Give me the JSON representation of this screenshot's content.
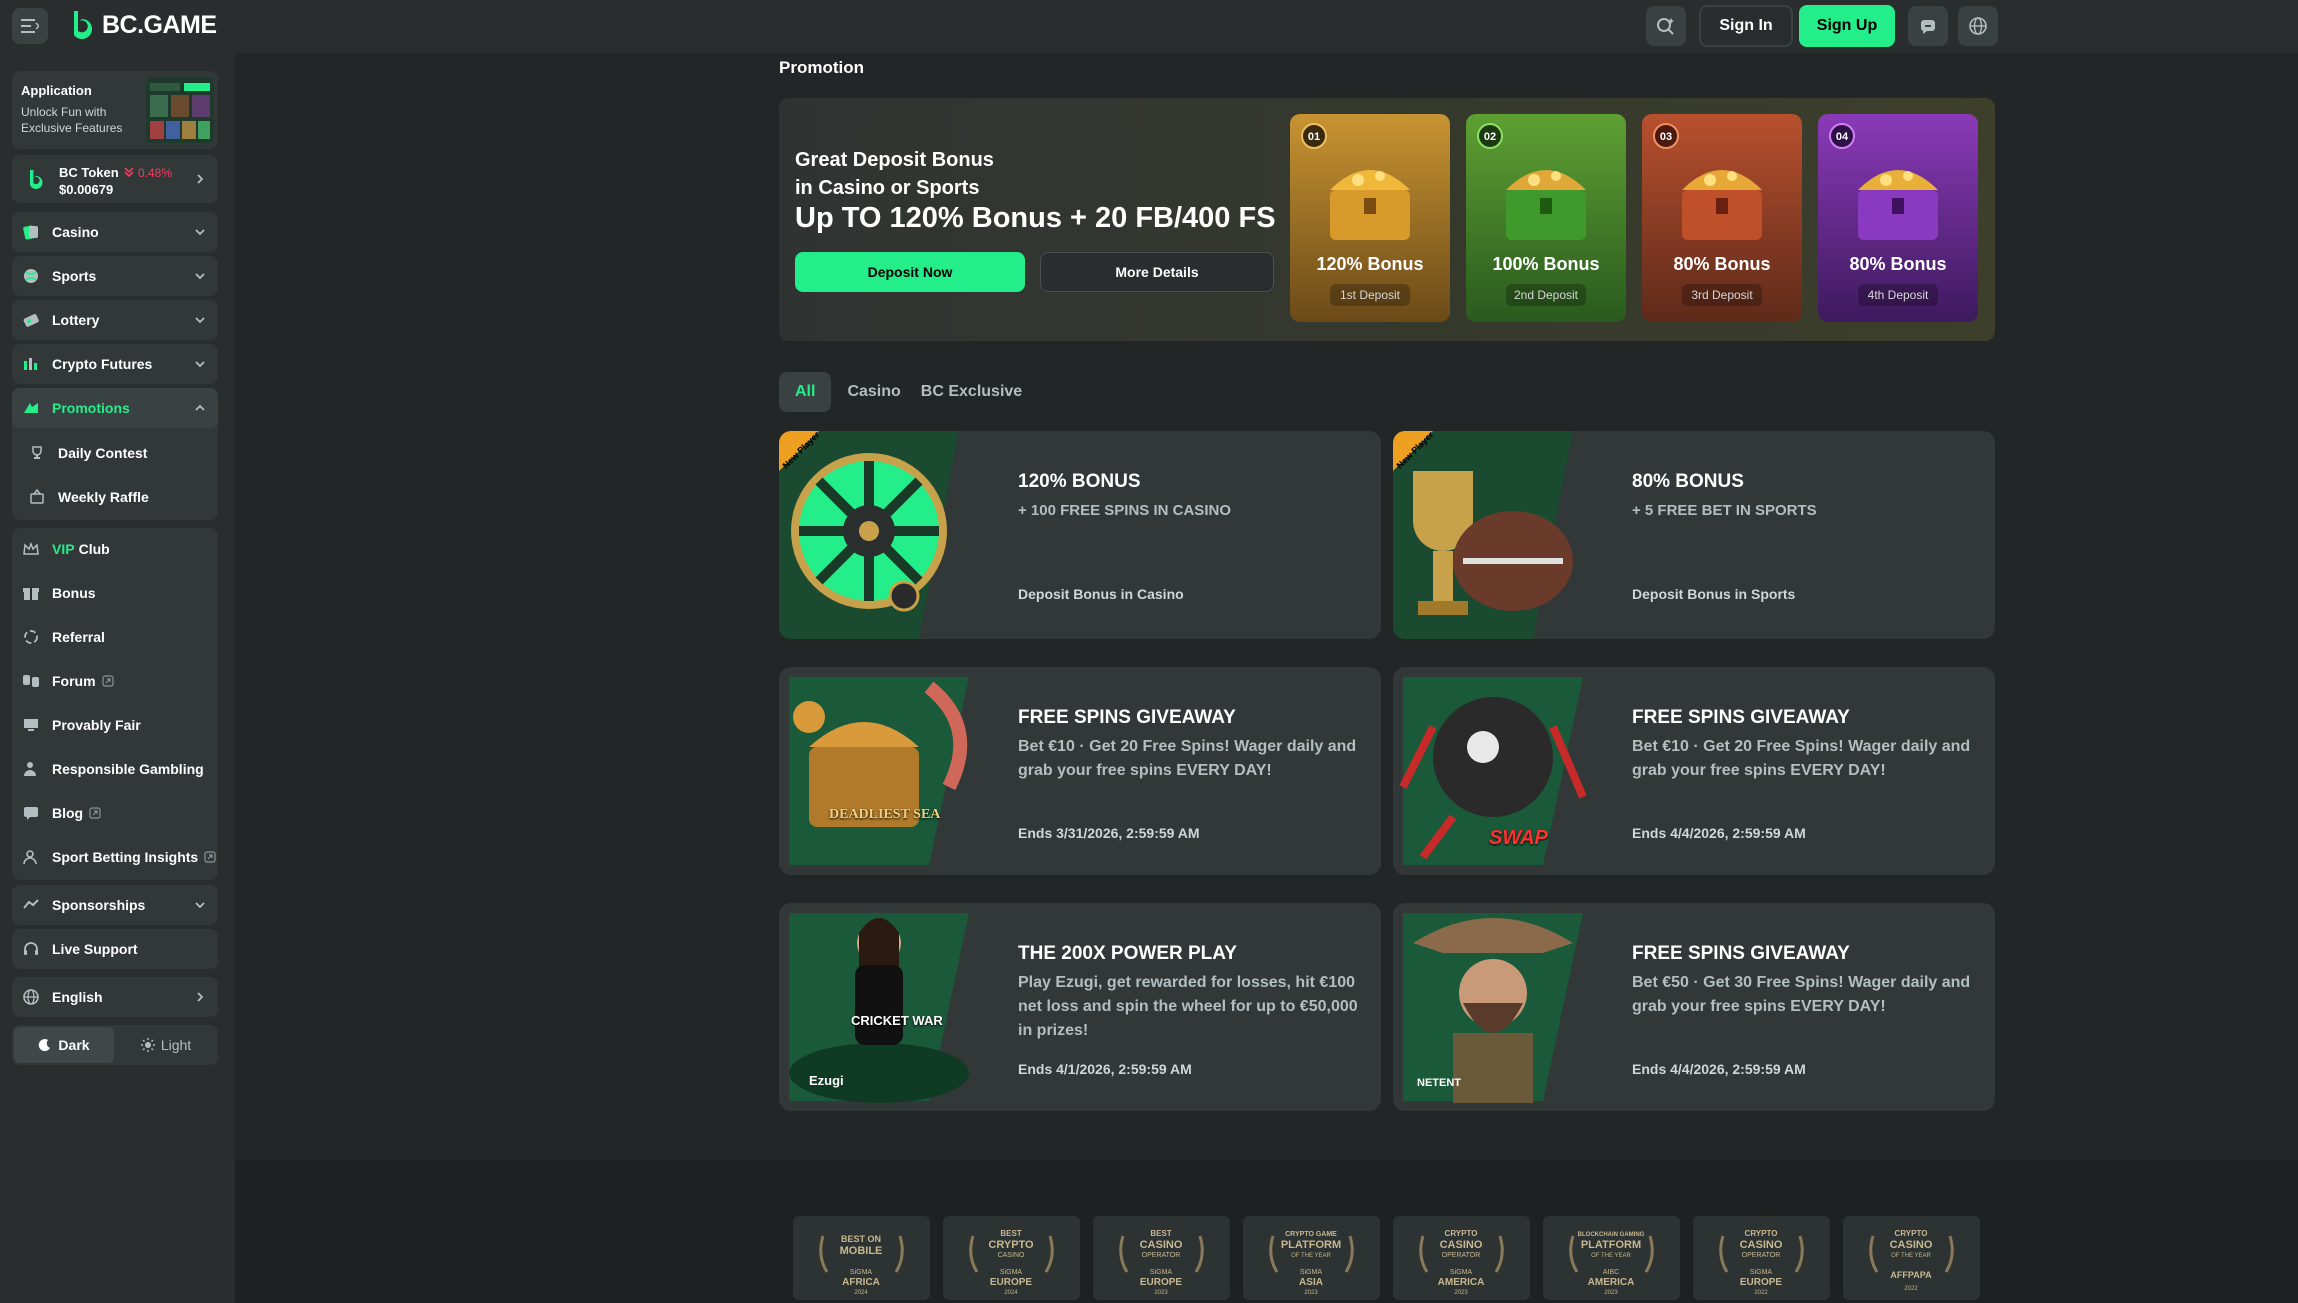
{
  "header": {
    "logo_text": "BC.GAME",
    "sign_in": "Sign In",
    "sign_up": "Sign Up",
    "accent_color": "#24ee89"
  },
  "sidebar": {
    "app": {
      "title": "Application",
      "subtitle1": "Unlock Fun with",
      "subtitle2": "Exclusive Features"
    },
    "token": {
      "name": "BC Token",
      "change": "0.48%",
      "price": "$0.00679"
    },
    "categories": [
      {
        "label": "Casino",
        "icon": "casino-icon"
      },
      {
        "label": "Sports",
        "icon": "sports-icon"
      },
      {
        "label": "Lottery",
        "icon": "lottery-icon"
      },
      {
        "label": "Crypto Futures",
        "icon": "crypto-futures-icon"
      }
    ],
    "promotions": {
      "label": "Promotions",
      "children": [
        "Daily Contest",
        "Weekly Raffle"
      ]
    },
    "links": [
      {
        "label_vip": "VIP",
        "label": "Club"
      },
      {
        "label": "Bonus"
      },
      {
        "label": "Referral"
      },
      {
        "label": "Forum"
      },
      {
        "label": "Provably Fair"
      },
      {
        "label": "Responsible Gambling"
      },
      {
        "label": "Blog"
      },
      {
        "label": "Sport Betting Insights"
      }
    ],
    "sponsorships": "Sponsorships",
    "live_support": "Live Support",
    "language": "English",
    "theme": {
      "dark": "Dark",
      "light": "Light",
      "selected": "Dark"
    }
  },
  "main": {
    "page_title": "Promotion",
    "hero": {
      "line1": "Great Deposit Bonus",
      "line2": "in Casino or Sports",
      "headline": "Up TO 120% Bonus + 20 FB/400 FS",
      "deposit_button": "Deposit Now",
      "details_button": "More Details",
      "tiers": [
        {
          "num": "01",
          "label": "120% Bonus",
          "sub": "1st Deposit",
          "color": "#b8862a"
        },
        {
          "num": "02",
          "label": "100% Bonus",
          "sub": "2nd Deposit",
          "color": "#3f8a28"
        },
        {
          "num": "03",
          "label": "80% Bonus",
          "sub": "3rd Deposit",
          "color": "#a8432a"
        },
        {
          "num": "04",
          "label": "80% Bonus",
          "sub": "4th Deposit",
          "color": "#7a2fa8"
        }
      ]
    },
    "tabs": [
      "All",
      "Casino",
      "BC Exclusive"
    ],
    "active_tab": "All",
    "cards": [
      {
        "title": "120% BONUS",
        "sub": "+ 100 FREE SPINS IN CASINO",
        "foot": "Deposit Bonus in Casino",
        "badge": "New Player"
      },
      {
        "title": "80% BONUS",
        "sub": "+ 5 FREE BET IN SPORTS",
        "foot": "Deposit Bonus in Sports",
        "badge": "New Player"
      },
      {
        "title": "FREE SPINS GIVEAWAY",
        "sub": "Bet €10 · Get 20 Free Spins! Wager daily and grab your free spins EVERY DAY!",
        "foot": "Ends 3/31/2026, 2:59:59 AM",
        "art_text": "DEADLIEST SEA"
      },
      {
        "title": "FREE SPINS GIVEAWAY",
        "sub": "Bet €10 · Get 20 Free Spins! Wager daily and grab your free spins EVERY DAY!",
        "foot": "Ends 4/4/2026, 2:59:59 AM",
        "art_text": "SWAP"
      },
      {
        "title": "THE 200X POWER PLAY",
        "sub": "Play Ezugi, get rewarded for losses, hit €100 net loss and spin the wheel for up to €50,000 in prizes!",
        "foot": "Ends 4/1/2026, 2:59:59 AM",
        "art_text": "CRICKET WAR",
        "art_brand": "Ezugi"
      },
      {
        "title": "FREE SPINS GIVEAWAY",
        "sub": "Bet €50 · Get 30 Free Spins! Wager daily and grab your free spins EVERY DAY!",
        "foot": "Ends 4/4/2026, 2:59:59 AM",
        "art_brand": "NETENT"
      }
    ],
    "awards": [
      {
        "line1": "BEST ON",
        "line2": "MOBILE",
        "org": "SiGMA",
        "region": "AFRICA",
        "year": "2024"
      },
      {
        "line1": "BEST",
        "line2": "CRYPTO",
        "line3": "CASINO",
        "org": "SiGMA",
        "region": "EUROPE",
        "year": "2024"
      },
      {
        "line1": "BEST",
        "line2": "CASINO",
        "line3": "OPERATOR",
        "org": "SiGMA",
        "region": "EUROPE",
        "year": "2023"
      },
      {
        "line1": "CRYPTO GAME",
        "line2": "PLATFORM",
        "line3": "OF THE YEAR",
        "org": "SiGMA",
        "region": "ASIA",
        "year": "2023"
      },
      {
        "line1": "CRYPTO",
        "line2": "CASINO",
        "line3": "OPERATOR",
        "org": "SiGMA",
        "region": "AMERICA",
        "year": "2023"
      },
      {
        "line1": "BLOCKCHAIN GAMING",
        "line2": "PLATFORM",
        "line3": "OF THE YEAR",
        "org": "AIBC",
        "region": "AMERICA",
        "year": "2023"
      },
      {
        "line1": "CRYPTO",
        "line2": "CASINO",
        "line3": "OPERATOR",
        "org": "SiGMA",
        "region": "EUROPE",
        "year": "2022"
      },
      {
        "line1": "CRYPTO",
        "line2": "CASINO",
        "line3": "OF THE YEAR",
        "org": "AFFPAPA",
        "region": "",
        "year": "2022"
      }
    ]
  }
}
